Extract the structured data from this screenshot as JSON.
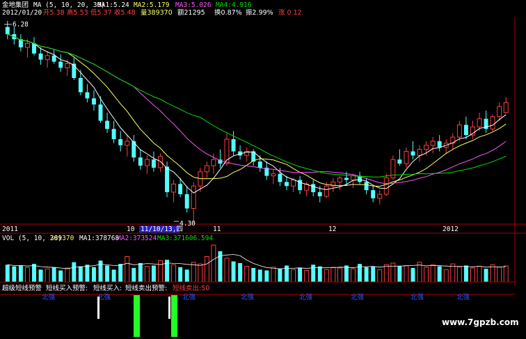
{
  "header": {
    "stock_name": "金地集团",
    "ma_label": "MA (5, 10, 20, 30)",
    "ma1": "MA1:5.24",
    "ma2": "MA2:5.179",
    "ma3": "MA3:5.026",
    "ma4": "MA4:4.916",
    "date": "2012/01/20",
    "open": "开5.38",
    "high": "高5.53",
    "low": "低5.37",
    "close": "收5.48",
    "volume": "量389370",
    "amount": "额21295",
    "turnover": "换0.87%",
    "amplitude": "振2.99%",
    "change": "涨 0.12"
  },
  "price_panel": {
    "high_mark": "6.28",
    "low_mark": "4.30",
    "x_labels": [
      "2011",
      "10",
      "11",
      "12",
      "2012"
    ],
    "cursor_date": "11/10/13,四"
  },
  "vol_panel": {
    "label": "VOL (5, 10, 20)",
    "vol": "389370",
    "ma1": "MA1:378768",
    "ma2": "MA2:373524",
    "ma3": "MA3:371606.594"
  },
  "signal_panel": {
    "title": "超级短线预警",
    "buy_warn": "短线买入预警:",
    "buy": "短线买入:",
    "sell_warn": "短线卖出预警:",
    "sell": "短线卖出:50",
    "markers": [
      "北强",
      "北强",
      "北强",
      "北强",
      "北强",
      "北强",
      "北强",
      "北强"
    ]
  },
  "watermark": "www.7gpzb.com",
  "colors": {
    "up": "#ff4040",
    "down": "#54ffff",
    "ma5": "#ffffff",
    "ma10": "#ffff66",
    "ma20": "#ff55ff",
    "ma30": "#00e000",
    "axis": "#b00000"
  },
  "chart_data": {
    "type": "candlestick",
    "y_range": [
      4.3,
      6.28
    ],
    "candles": [
      {
        "o": 6.22,
        "h": 6.28,
        "l": 6.1,
        "c": 6.15
      },
      {
        "o": 6.15,
        "h": 6.22,
        "l": 6.05,
        "c": 6.1
      },
      {
        "o": 6.1,
        "h": 6.15,
        "l": 5.98,
        "c": 6.02
      },
      {
        "o": 6.02,
        "h": 6.1,
        "l": 5.92,
        "c": 6.06
      },
      {
        "o": 6.06,
        "h": 6.12,
        "l": 5.94,
        "c": 5.96
      },
      {
        "o": 5.96,
        "h": 6.02,
        "l": 5.85,
        "c": 5.9
      },
      {
        "o": 5.9,
        "h": 5.98,
        "l": 5.82,
        "c": 5.94
      },
      {
        "o": 5.94,
        "h": 6.0,
        "l": 5.86,
        "c": 5.88
      },
      {
        "o": 5.88,
        "h": 5.95,
        "l": 5.78,
        "c": 5.82
      },
      {
        "o": 5.82,
        "h": 5.9,
        "l": 5.74,
        "c": 5.86
      },
      {
        "o": 5.86,
        "h": 5.92,
        "l": 5.7,
        "c": 5.72
      },
      {
        "o": 5.72,
        "h": 5.8,
        "l": 5.55,
        "c": 5.58
      },
      {
        "o": 5.58,
        "h": 5.66,
        "l": 5.48,
        "c": 5.52
      },
      {
        "o": 5.52,
        "h": 5.6,
        "l": 5.4,
        "c": 5.46
      },
      {
        "o": 5.46,
        "h": 5.54,
        "l": 5.28,
        "c": 5.3
      },
      {
        "o": 5.3,
        "h": 5.38,
        "l": 5.18,
        "c": 5.22
      },
      {
        "o": 5.22,
        "h": 5.3,
        "l": 5.08,
        "c": 5.12
      },
      {
        "o": 5.12,
        "h": 5.2,
        "l": 5.0,
        "c": 5.06
      },
      {
        "o": 5.06,
        "h": 5.16,
        "l": 4.95,
        "c": 5.1
      },
      {
        "o": 5.1,
        "h": 5.16,
        "l": 4.9,
        "c": 4.94
      },
      {
        "o": 4.94,
        "h": 5.02,
        "l": 4.82,
        "c": 4.86
      },
      {
        "o": 4.86,
        "h": 4.96,
        "l": 4.78,
        "c": 4.92
      },
      {
        "o": 4.92,
        "h": 5.0,
        "l": 4.8,
        "c": 4.84
      },
      {
        "o": 4.84,
        "h": 4.98,
        "l": 4.8,
        "c": 4.95
      },
      {
        "o": 4.85,
        "h": 4.9,
        "l": 4.55,
        "c": 4.6
      },
      {
        "o": 4.6,
        "h": 4.72,
        "l": 4.5,
        "c": 4.68
      },
      {
        "o": 4.68,
        "h": 4.74,
        "l": 4.55,
        "c": 4.58
      },
      {
        "o": 4.58,
        "h": 4.66,
        "l": 4.4,
        "c": 4.44
      },
      {
        "o": 4.44,
        "h": 4.7,
        "l": 4.3,
        "c": 4.66
      },
      {
        "o": 4.66,
        "h": 4.84,
        "l": 4.6,
        "c": 4.8
      },
      {
        "o": 4.8,
        "h": 4.9,
        "l": 4.74,
        "c": 4.86
      },
      {
        "o": 4.86,
        "h": 4.98,
        "l": 4.78,
        "c": 4.92
      },
      {
        "o": 4.92,
        "h": 5.02,
        "l": 4.84,
        "c": 4.88
      },
      {
        "o": 4.88,
        "h": 5.18,
        "l": 4.86,
        "c": 5.12
      },
      {
        "o": 5.12,
        "h": 5.2,
        "l": 4.96,
        "c": 5.0
      },
      {
        "o": 5.0,
        "h": 5.06,
        "l": 4.92,
        "c": 4.96
      },
      {
        "o": 4.96,
        "h": 5.04,
        "l": 4.9,
        "c": 5.0
      },
      {
        "o": 5.0,
        "h": 5.02,
        "l": 4.86,
        "c": 4.9
      },
      {
        "o": 4.9,
        "h": 4.96,
        "l": 4.8,
        "c": 4.84
      },
      {
        "o": 4.84,
        "h": 4.9,
        "l": 4.72,
        "c": 4.76
      },
      {
        "o": 4.76,
        "h": 4.82,
        "l": 4.68,
        "c": 4.78
      },
      {
        "o": 4.78,
        "h": 4.84,
        "l": 4.66,
        "c": 4.7
      },
      {
        "o": 4.7,
        "h": 4.76,
        "l": 4.62,
        "c": 4.66
      },
      {
        "o": 4.66,
        "h": 4.74,
        "l": 4.6,
        "c": 4.72
      },
      {
        "o": 4.72,
        "h": 4.76,
        "l": 4.58,
        "c": 4.62
      },
      {
        "o": 4.62,
        "h": 4.7,
        "l": 4.56,
        "c": 4.68
      },
      {
        "o": 4.68,
        "h": 4.72,
        "l": 4.56,
        "c": 4.6
      },
      {
        "o": 4.6,
        "h": 4.66,
        "l": 4.5,
        "c": 4.56
      },
      {
        "o": 4.56,
        "h": 4.7,
        "l": 4.54,
        "c": 4.66
      },
      {
        "o": 4.66,
        "h": 4.74,
        "l": 4.6,
        "c": 4.7
      },
      {
        "o": 4.7,
        "h": 4.76,
        "l": 4.62,
        "c": 4.74
      },
      {
        "o": 4.74,
        "h": 4.8,
        "l": 4.66,
        "c": 4.72
      },
      {
        "o": 4.72,
        "h": 4.78,
        "l": 4.64,
        "c": 4.76
      },
      {
        "o": 4.76,
        "h": 4.8,
        "l": 4.68,
        "c": 4.7
      },
      {
        "o": 4.7,
        "h": 4.74,
        "l": 4.58,
        "c": 4.62
      },
      {
        "o": 4.62,
        "h": 4.66,
        "l": 4.5,
        "c": 4.54
      },
      {
        "o": 4.54,
        "h": 4.62,
        "l": 4.48,
        "c": 4.58
      },
      {
        "o": 4.58,
        "h": 4.78,
        "l": 4.56,
        "c": 4.74
      },
      {
        "o": 4.74,
        "h": 4.96,
        "l": 4.72,
        "c": 4.92
      },
      {
        "o": 4.92,
        "h": 5.02,
        "l": 4.86,
        "c": 4.88
      },
      {
        "o": 4.88,
        "h": 5.04,
        "l": 4.84,
        "c": 5.0
      },
      {
        "o": 5.0,
        "h": 5.1,
        "l": 4.92,
        "c": 4.96
      },
      {
        "o": 4.96,
        "h": 5.06,
        "l": 4.9,
        "c": 5.02
      },
      {
        "o": 5.02,
        "h": 5.1,
        "l": 4.96,
        "c": 5.06
      },
      {
        "o": 5.06,
        "h": 5.14,
        "l": 4.98,
        "c": 5.1
      },
      {
        "o": 5.1,
        "h": 5.16,
        "l": 5.0,
        "c": 5.04
      },
      {
        "o": 5.04,
        "h": 5.12,
        "l": 4.98,
        "c": 5.08
      },
      {
        "o": 5.08,
        "h": 5.18,
        "l": 5.02,
        "c": 5.14
      },
      {
        "o": 5.14,
        "h": 5.3,
        "l": 5.1,
        "c": 5.26
      },
      {
        "o": 5.26,
        "h": 5.34,
        "l": 5.12,
        "c": 5.16
      },
      {
        "o": 5.16,
        "h": 5.3,
        "l": 5.12,
        "c": 5.24
      },
      {
        "o": 5.24,
        "h": 5.38,
        "l": 5.2,
        "c": 5.32
      },
      {
        "o": 5.32,
        "h": 5.4,
        "l": 5.18,
        "c": 5.22
      },
      {
        "o": 5.22,
        "h": 5.36,
        "l": 5.2,
        "c": 5.34
      },
      {
        "o": 5.34,
        "h": 5.48,
        "l": 5.3,
        "c": 5.44
      },
      {
        "o": 5.38,
        "h": 5.53,
        "l": 5.37,
        "c": 5.48
      }
    ],
    "ma_series": [
      {
        "name": "MA5"
      },
      {
        "name": "MA10"
      },
      {
        "name": "MA20"
      },
      {
        "name": "MA30"
      }
    ],
    "volume": [
      42,
      38,
      40,
      35,
      44,
      30,
      32,
      36,
      28,
      34,
      48,
      38,
      42,
      36,
      52,
      40,
      30,
      44,
      62,
      34,
      46,
      38,
      40,
      52,
      54,
      42,
      36,
      30,
      48,
      44,
      62,
      90,
      75,
      58,
      50,
      46,
      38,
      34,
      30,
      28,
      36,
      32,
      40,
      30,
      34,
      28,
      42,
      38,
      30,
      36,
      34,
      40,
      32,
      44,
      36,
      38,
      30,
      42,
      46,
      38,
      40,
      34,
      48,
      36,
      42,
      38,
      30,
      44,
      36,
      40,
      34,
      38,
      32,
      42,
      36,
      39
    ]
  }
}
